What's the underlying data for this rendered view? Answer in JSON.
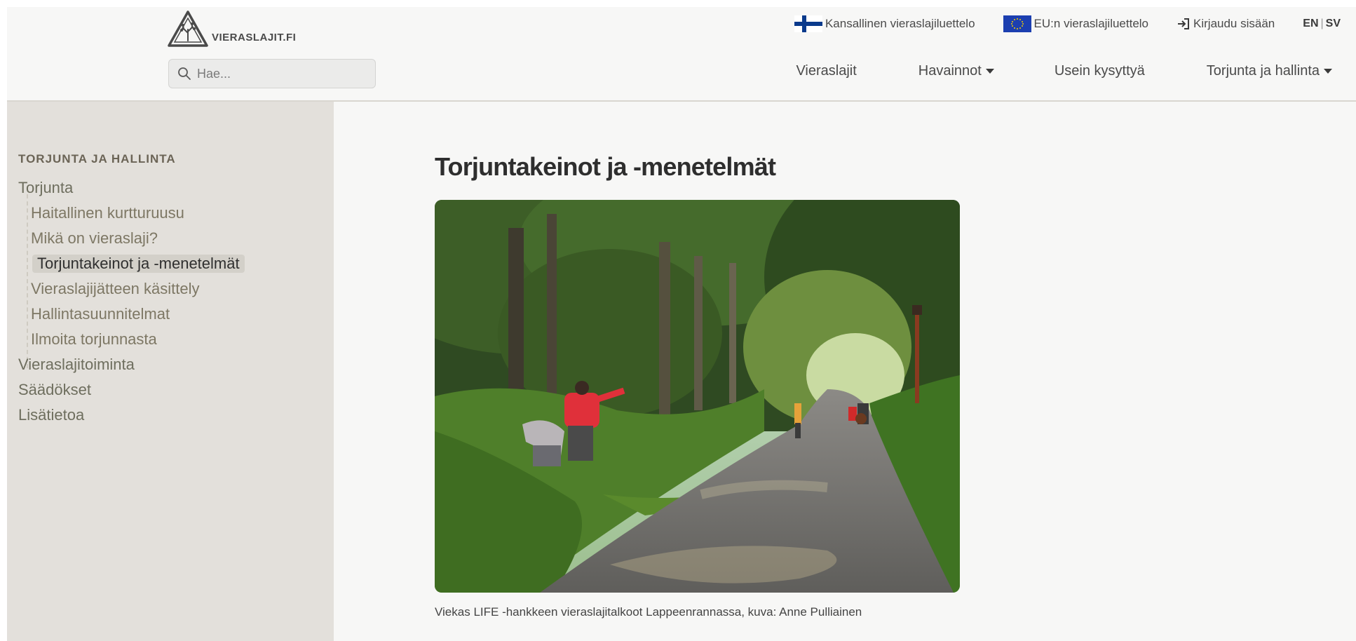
{
  "header": {
    "logo_text": "VIERASLAJIT.FI",
    "search": {
      "placeholder": "Hae..."
    },
    "top_links": {
      "national_list": "Kansallinen vieraslajiluettelo",
      "eu_list": "EU:n vieraslajiluettelo",
      "login": "Kirjaudu sisään",
      "lang_en": "EN",
      "lang_sep": "|",
      "lang_sv": "SV"
    },
    "nav": {
      "vieraslajit": "Vieraslajit",
      "havainnot": "Havainnot",
      "usein": "Usein kysyttyä",
      "torjunta": "Torjunta ja hallinta"
    }
  },
  "sidebar": {
    "title": "TORJUNTA JA HALLINTA",
    "items": [
      {
        "label": "Torjunta"
      },
      {
        "label": "Vieraslajitoiminta"
      },
      {
        "label": "Säädökset"
      },
      {
        "label": "Lisätietoa"
      }
    ],
    "subitems": [
      {
        "label": "Haitallinen kurtturuusu"
      },
      {
        "label": "Mikä on vieraslaji?"
      },
      {
        "label": "Torjuntakeinot ja -menetelmät"
      },
      {
        "label": "Vieraslajijätteen käsittely"
      },
      {
        "label": "Hallintasuunnitelmat"
      },
      {
        "label": "Ilmoita torjunnasta"
      }
    ]
  },
  "main": {
    "title": "Torjuntakeinot ja -menetelmät",
    "caption": "Viekas LIFE -hankkeen vieraslajitalkoot Lappeenrannassa, kuva: Anne Pulliainen"
  },
  "colors": {
    "sidebar_bg": "#e3e0db",
    "header_bg": "#f7f7f6",
    "active_bg": "#d3d0c9"
  }
}
